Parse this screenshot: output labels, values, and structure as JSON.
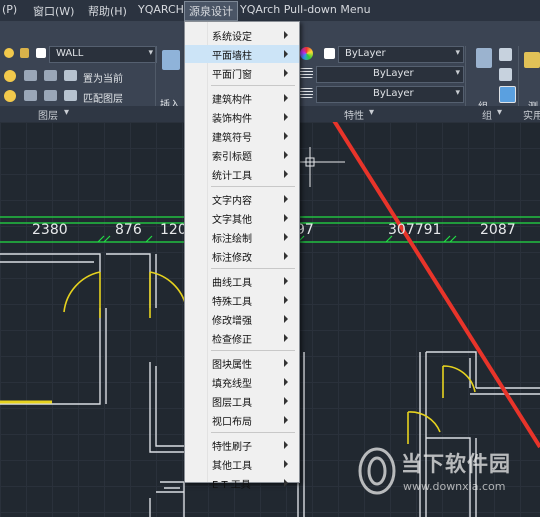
{
  "menubar": {
    "items": [
      "(P)",
      "窗口(W)",
      "帮助(H)",
      "YQARCH",
      "源泉设计",
      "YQArch Pull-down Menu"
    ],
    "active_index": 4
  },
  "ribbon": {
    "layer_name": "WALL",
    "set_current": "置为当前",
    "match_layer": "匹配图层",
    "layers_panel": "图层",
    "insert_label": "插入",
    "bylayer_1": "ByLayer",
    "bylayer_2": "ByLayer",
    "bylayer_3": "ByLayer",
    "properties_panel": "特性",
    "group_label": "组",
    "group_panel": "组",
    "measure_label": "测",
    "utility_panel": "实用"
  },
  "drawing": {
    "dimensions": [
      "2380",
      "876",
      "120",
      "97",
      "307791",
      "2087"
    ],
    "accent_green": "#22dd44",
    "door_yellow": "#e6d21e",
    "arrow_red": "#e8342a"
  },
  "context_menu": {
    "selected_index": 1,
    "items": [
      {
        "label": "系统设定",
        "arrow": true
      },
      {
        "label": "平面墙柱",
        "arrow": true
      },
      {
        "label": "平面门窗",
        "arrow": true
      },
      {
        "label": "建筑构件",
        "arrow": true
      },
      {
        "label": "装饰构件",
        "arrow": true
      },
      {
        "label": "建筑符号",
        "arrow": true
      },
      {
        "label": "索引标题",
        "arrow": true
      },
      {
        "label": "统计工具",
        "arrow": true
      },
      {
        "label": "文字内容",
        "arrow": true
      },
      {
        "label": "文字其他",
        "arrow": true
      },
      {
        "label": "标注绘制",
        "arrow": true
      },
      {
        "label": "标注修改",
        "arrow": true
      },
      {
        "label": "曲线工具",
        "arrow": true
      },
      {
        "label": "特殊工具",
        "arrow": true
      },
      {
        "label": "修改增强",
        "arrow": true
      },
      {
        "label": "检查修正",
        "arrow": true
      },
      {
        "label": "图块属性",
        "arrow": true
      },
      {
        "label": "填充线型",
        "arrow": true
      },
      {
        "label": "图层工具",
        "arrow": true
      },
      {
        "label": "视口布局",
        "arrow": true
      },
      {
        "label": "特性刷子",
        "arrow": true
      },
      {
        "label": "其他工具",
        "arrow": true
      },
      {
        "label": "E T 工具",
        "arrow": true
      }
    ]
  },
  "watermark": {
    "name": "当下软件园",
    "url": "www.downxia.com"
  }
}
